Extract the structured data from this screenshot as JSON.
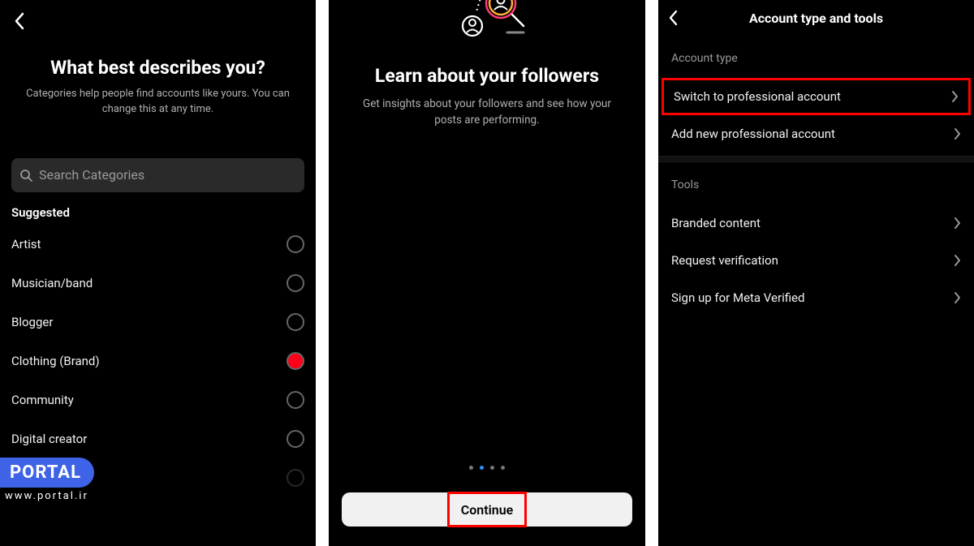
{
  "phone1": {
    "title": "What best describes you?",
    "subtitle": "Categories help people find accounts like yours. You can change this at any time.",
    "search_placeholder": "Search Categories",
    "suggested_label": "Suggested",
    "categories": [
      {
        "label": "Artist",
        "selected": false
      },
      {
        "label": "Musician/band",
        "selected": false
      },
      {
        "label": "Blogger",
        "selected": false
      },
      {
        "label": "Clothing (Brand)",
        "selected": true
      },
      {
        "label": "Community",
        "selected": false
      },
      {
        "label": "Digital creator",
        "selected": false
      }
    ]
  },
  "phone2": {
    "title": "Learn about your followers",
    "subtitle": "Get insights about your followers and see how your posts are performing.",
    "continue_label": "Continue",
    "active_page_index": 1,
    "page_count": 4
  },
  "phone3": {
    "header_title": "Account type and tools",
    "account_type_label": "Account type",
    "tools_label": "Tools",
    "account_type_items": [
      {
        "label": "Switch to professional account",
        "highlighted": true
      },
      {
        "label": "Add new professional account",
        "highlighted": false
      }
    ],
    "tools_items": [
      {
        "label": "Branded content"
      },
      {
        "label": "Request verification"
      },
      {
        "label": "Sign up for Meta Verified"
      }
    ]
  },
  "watermark": {
    "badge": "PORTAL",
    "url": "www.portal.ir"
  }
}
